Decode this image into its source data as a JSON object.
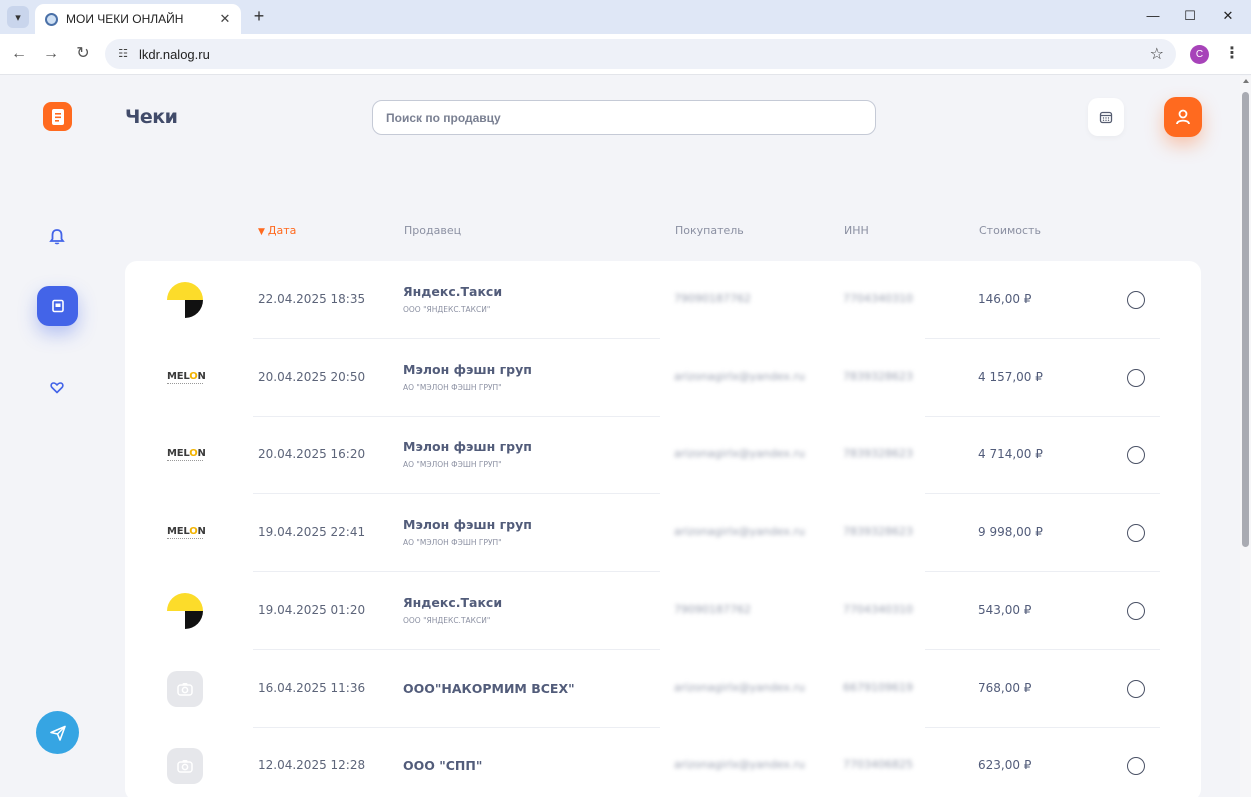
{
  "browser": {
    "tab_title": "МОИ ЧЕКИ ОНЛАЙН",
    "url": "lkdr.nalog.ru",
    "profile_initial": "C"
  },
  "app": {
    "title": "Чеки",
    "search_placeholder": "Поиск по продавцу",
    "accent": "#ff6a1f",
    "primary": "#4364e8"
  },
  "columns": {
    "date": "Дата",
    "seller": "Продавец",
    "buyer": "Покупатель",
    "inn": "ИНН",
    "price": "Стоимость"
  },
  "rows": [
    {
      "logo": "yandex",
      "date": "22.04.2025 18:35",
      "seller": "Яндекс.Такси",
      "legal": "ООО \"ЯНДЕКС.ТАКСИ\"",
      "buyer": "79090187762",
      "inn": "7704340310",
      "price": "146,00 ₽"
    },
    {
      "logo": "melon",
      "date": "20.04.2025 20:50",
      "seller": "Мэлон фэшн груп",
      "legal": "АО \"МЭЛОН ФЭШН ГРУП\"",
      "buyer": "arizonagirlx@yandex.ru",
      "inn": "7839328623",
      "price": "4 157,00 ₽"
    },
    {
      "logo": "melon",
      "date": "20.04.2025 16:20",
      "seller": "Мэлон фэшн груп",
      "legal": "АО \"МЭЛОН ФЭШН ГРУП\"",
      "buyer": "arizonagirlx@yandex.ru",
      "inn": "7839328623",
      "price": "4 714,00 ₽"
    },
    {
      "logo": "melon",
      "date": "19.04.2025 22:41",
      "seller": "Мэлон фэшн груп",
      "legal": "АО \"МЭЛОН ФЭШН ГРУП\"",
      "buyer": "arizonagirlx@yandex.ru",
      "inn": "7839328623",
      "price": "9 998,00 ₽"
    },
    {
      "logo": "yandex",
      "date": "19.04.2025 01:20",
      "seller": "Яндекс.Такси",
      "legal": "ООО \"ЯНДЕКС.ТАКСИ\"",
      "buyer": "79090187762",
      "inn": "7704340310",
      "price": "543,00 ₽"
    },
    {
      "logo": "generic",
      "date": "16.04.2025 11:36",
      "seller": "ООО\"НАКОРМИМ ВСЕХ\"",
      "legal": "",
      "buyer": "arizonagirlx@yandex.ru",
      "inn": "6679109619",
      "price": "768,00 ₽"
    },
    {
      "logo": "generic",
      "date": "12.04.2025 12:28",
      "seller": "ООО \"СПП\"",
      "legal": "",
      "buyer": "arizonagirlx@yandex.ru",
      "inn": "7703406825",
      "price": "623,00 ₽"
    }
  ],
  "melon_logo": {
    "pre": "MEL",
    "o": "O",
    "post": "N"
  }
}
